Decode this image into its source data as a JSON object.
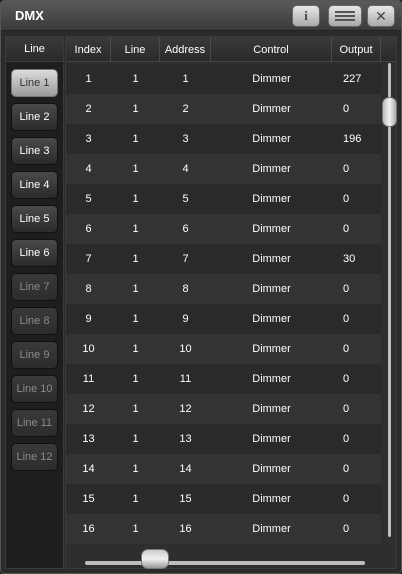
{
  "window": {
    "title": "DMX"
  },
  "titlebar": {
    "info_label": "i",
    "close_label": "✕"
  },
  "line_panel": {
    "header": "Line",
    "lines": [
      {
        "label": "Line 1",
        "state": "selected"
      },
      {
        "label": "Line 2",
        "state": "active"
      },
      {
        "label": "Line 3",
        "state": "active"
      },
      {
        "label": "Line 4",
        "state": "active"
      },
      {
        "label": "Line 5",
        "state": "active"
      },
      {
        "label": "Line 6",
        "state": "active"
      },
      {
        "label": "Line 7",
        "state": "dim"
      },
      {
        "label": "Line 8",
        "state": "dim"
      },
      {
        "label": "Line 9",
        "state": "dim"
      },
      {
        "label": "Line 10",
        "state": "dim"
      },
      {
        "label": "Line 11",
        "state": "dim"
      },
      {
        "label": "Line 12",
        "state": "dim"
      }
    ]
  },
  "table": {
    "columns": [
      "Index",
      "Line",
      "Address",
      "Control",
      "Output"
    ],
    "rows": [
      {
        "index": "1",
        "line": "1",
        "address": "1",
        "control": "Dimmer",
        "output": "227"
      },
      {
        "index": "2",
        "line": "1",
        "address": "2",
        "control": "Dimmer",
        "output": "0"
      },
      {
        "index": "3",
        "line": "1",
        "address": "3",
        "control": "Dimmer",
        "output": "196"
      },
      {
        "index": "4",
        "line": "1",
        "address": "4",
        "control": "Dimmer",
        "output": "0"
      },
      {
        "index": "5",
        "line": "1",
        "address": "5",
        "control": "Dimmer",
        "output": "0"
      },
      {
        "index": "6",
        "line": "1",
        "address": "6",
        "control": "Dimmer",
        "output": "0"
      },
      {
        "index": "7",
        "line": "1",
        "address": "7",
        "control": "Dimmer",
        "output": "30"
      },
      {
        "index": "8",
        "line": "1",
        "address": "8",
        "control": "Dimmer",
        "output": "0"
      },
      {
        "index": "9",
        "line": "1",
        "address": "9",
        "control": "Dimmer",
        "output": "0"
      },
      {
        "index": "10",
        "line": "1",
        "address": "10",
        "control": "Dimmer",
        "output": "0"
      },
      {
        "index": "11",
        "line": "1",
        "address": "11",
        "control": "Dimmer",
        "output": "0"
      },
      {
        "index": "12",
        "line": "1",
        "address": "12",
        "control": "Dimmer",
        "output": "0"
      },
      {
        "index": "13",
        "line": "1",
        "address": "13",
        "control": "Dimmer",
        "output": "0"
      },
      {
        "index": "14",
        "line": "1",
        "address": "14",
        "control": "Dimmer",
        "output": "0"
      },
      {
        "index": "15",
        "line": "1",
        "address": "15",
        "control": "Dimmer",
        "output": "0"
      },
      {
        "index": "16",
        "line": "1",
        "address": "16",
        "control": "Dimmer",
        "output": "0"
      }
    ]
  },
  "icons": {
    "info": "info-icon",
    "menu": "menu-icon",
    "close": "close-icon"
  }
}
